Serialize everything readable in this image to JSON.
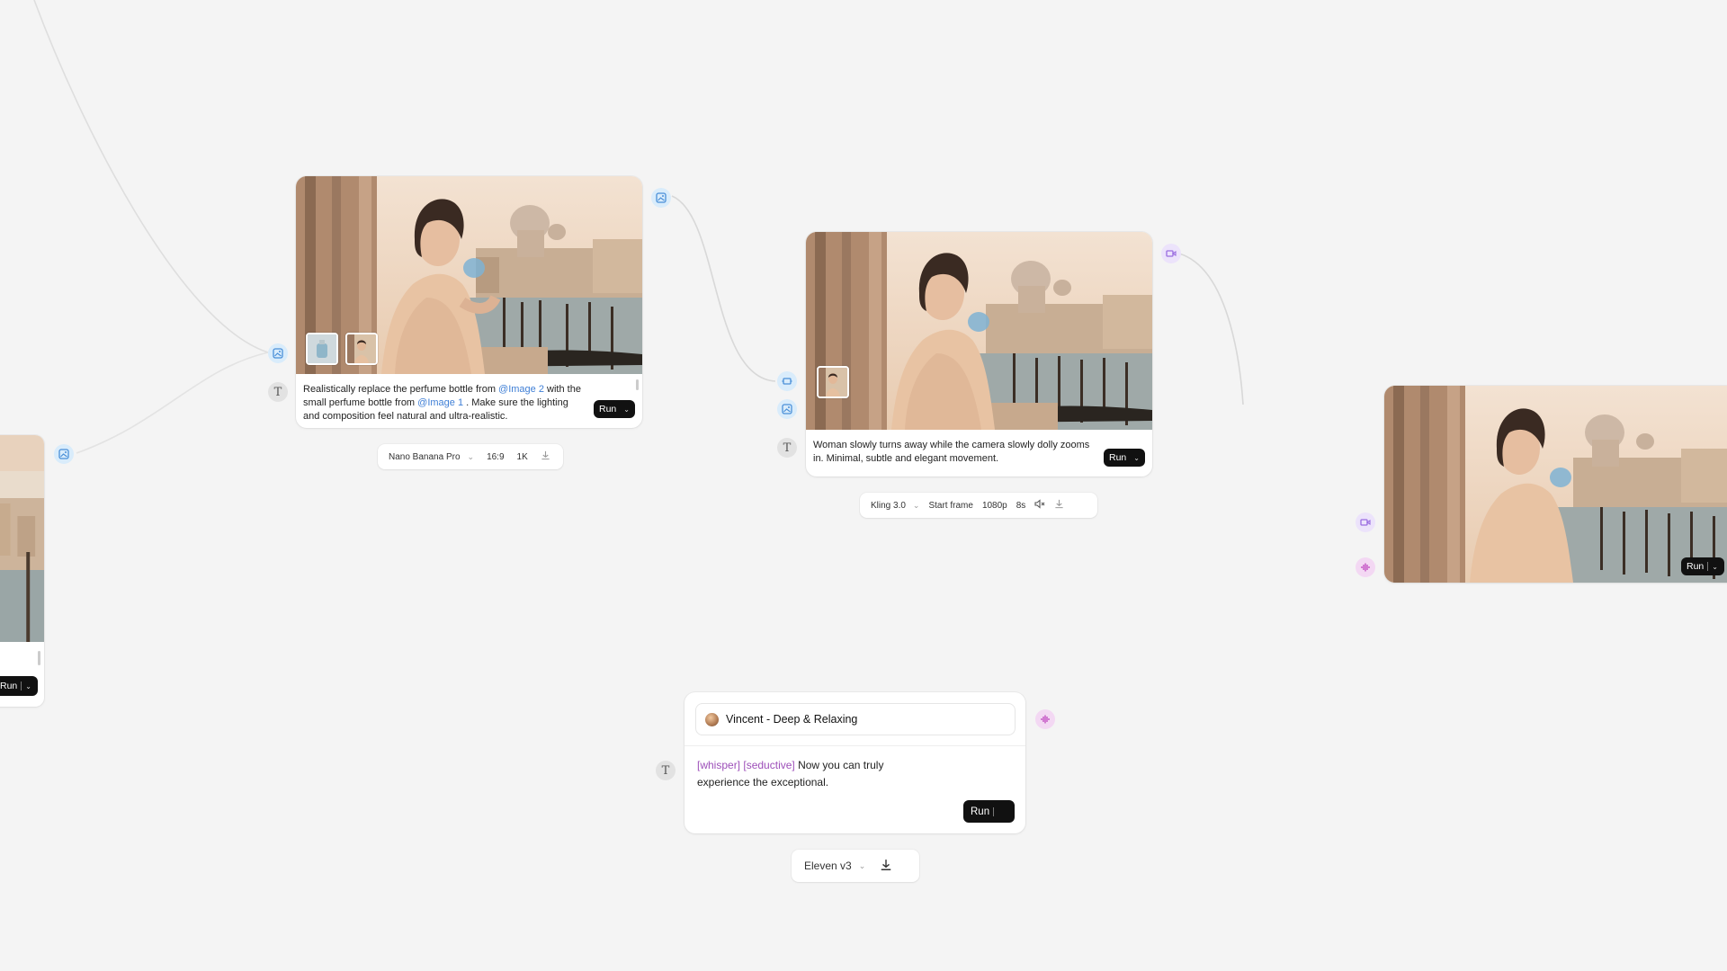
{
  "colors": {
    "canvas_bg": "#f4f4f4",
    "image_port": "#d9ecfb",
    "video_port": "#ece3fb",
    "audio_port": "#f3d8f3",
    "mention": "#3f7fd6",
    "audio_tag": "#9d4fb9",
    "run_button": "#111111"
  },
  "image_node": {
    "prompt_part1": "Realistically replace the perfume bottle from ",
    "mention1": "@Image 2",
    "prompt_part2": " with the small perfume bottle from ",
    "mention2": "@Image 1",
    "prompt_part3": " . Make sure the lighting and composition feel natural and ultra-realistic.",
    "run_label": "Run",
    "toolbar": {
      "model": "Nano Banana Pro",
      "aspect": "16:9",
      "resolution": "1K",
      "download_icon": "download-icon"
    }
  },
  "video_node": {
    "prompt": "Woman slowly turns away while the camera slowly dolly zooms in. Minimal, subtle and elegant movement.",
    "run_label": "Run",
    "toolbar": {
      "model": "Kling 3.0",
      "frame_mode": "Start frame",
      "resolution": "1080p",
      "duration": "8s",
      "mute_icon": "speaker-muted-icon",
      "download_icon": "download-icon"
    }
  },
  "output_node": {
    "run_label": "Run"
  },
  "left_node": {
    "run_label": "Run"
  },
  "audio_node": {
    "voice": "Vincent - Deep & Relaxing",
    "tag1": "[whisper]",
    "tag2": "[seductive]",
    "text": "Now you can truly experience the exceptional.",
    "run_label": "Run",
    "toolbar": {
      "model": "Eleven v3",
      "download_icon": "download-icon"
    }
  }
}
